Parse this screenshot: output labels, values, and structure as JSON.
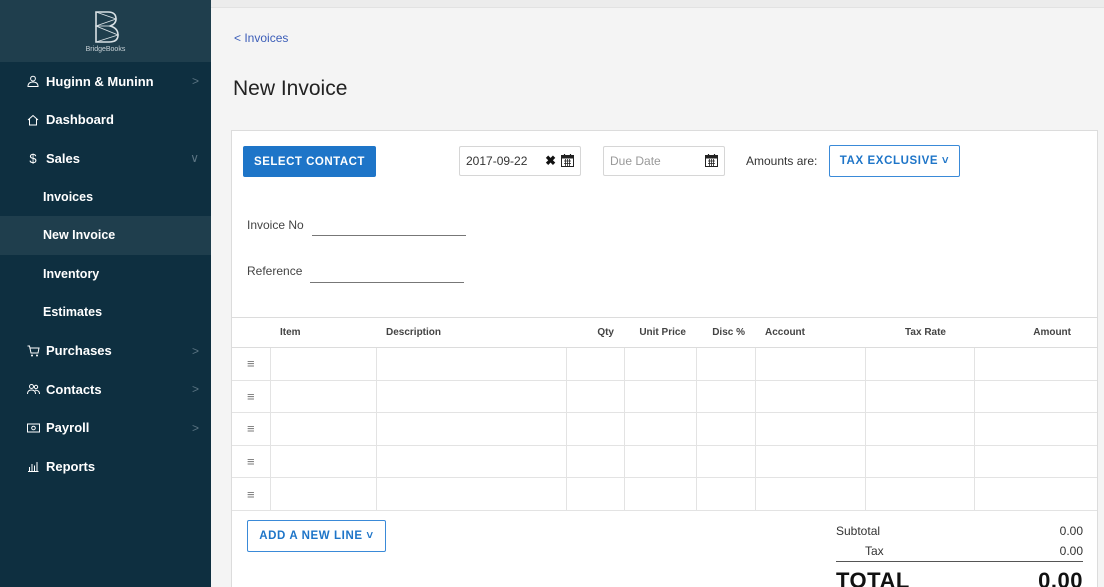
{
  "sidebar": {
    "brand_name": "BridgeBooks",
    "org": {
      "label": "Huginn & Muninn"
    },
    "items": [
      {
        "label": "Dashboard"
      },
      {
        "label": "Sales"
      },
      {
        "label": "Purchases"
      },
      {
        "label": "Contacts"
      },
      {
        "label": "Payroll"
      },
      {
        "label": "Reports"
      }
    ],
    "sales_sub": [
      {
        "label": "Invoices"
      },
      {
        "label": "New Invoice"
      },
      {
        "label": "Inventory"
      },
      {
        "label": "Estimates"
      }
    ],
    "colors": {
      "background": "#0e2f40",
      "active": "#1f3e4d"
    }
  },
  "breadcrumb": {
    "back_label": "< Invoices"
  },
  "page": {
    "title": "New Invoice"
  },
  "toolbar": {
    "select_contact_label": "SELECT CONTACT",
    "date_value": "2017-09-22",
    "due_date_placeholder": "Due Date",
    "amounts_label": "Amounts are:",
    "tax_mode_label": "TAX EXCLUSIVE ˅"
  },
  "form": {
    "invoice_no_label": "Invoice No",
    "reference_label": "Reference"
  },
  "table": {
    "columns": [
      "Item",
      "Description",
      "Qty",
      "Unit Price",
      "Disc %",
      "Account",
      "Tax Rate",
      "Amount"
    ],
    "row_count": 5
  },
  "footer": {
    "add_line_label": "ADD A NEW LINE ˅",
    "subtotal_label": "Subtotal",
    "subtotal_value": "0.00",
    "tax_label": "Tax",
    "tax_value": "0.00",
    "total_label": "TOTAL",
    "total_value": "0.00"
  },
  "colors": {
    "primary": "#1e75c8",
    "link": "#3b5db8"
  }
}
